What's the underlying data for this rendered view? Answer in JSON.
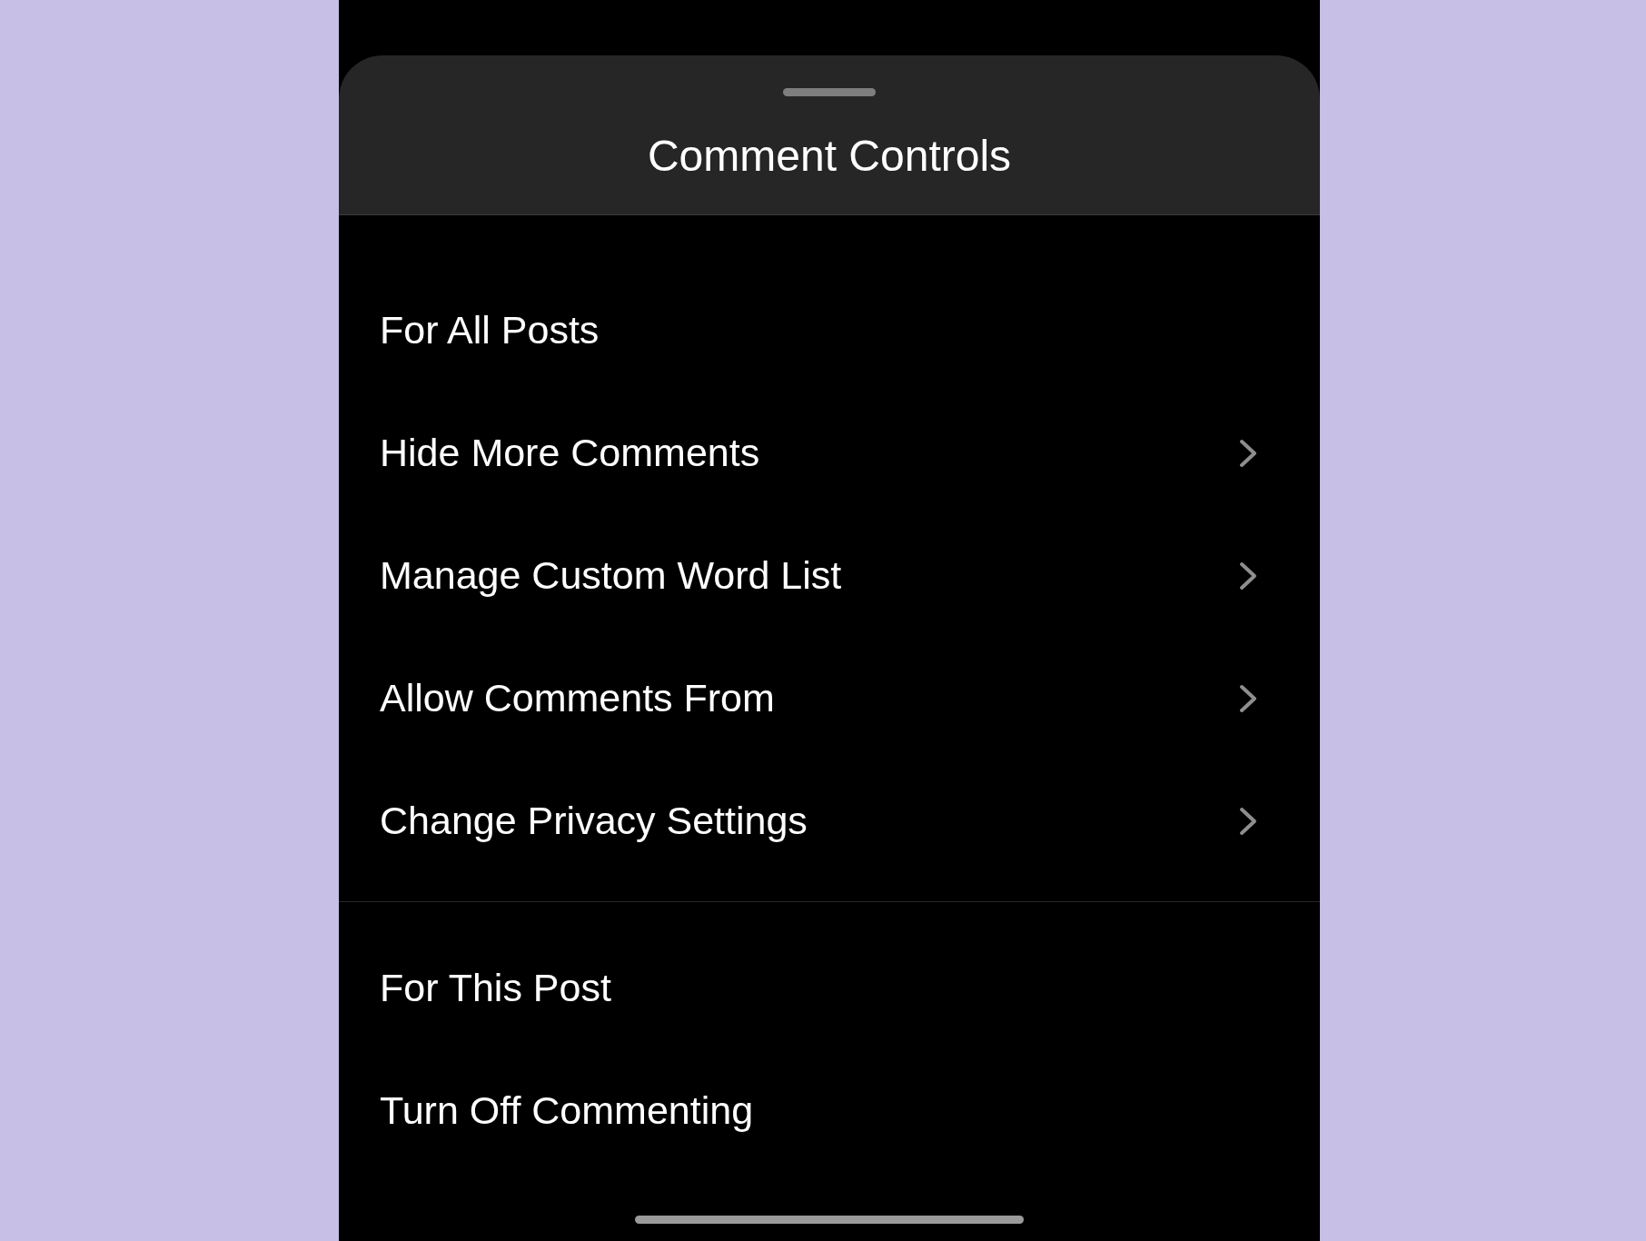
{
  "sheet": {
    "title": "Comment Controls"
  },
  "sections": [
    {
      "heading": "For All Posts",
      "items": [
        {
          "label": "Hide More Comments",
          "kind": "link"
        },
        {
          "label": "Manage Custom Word List",
          "kind": "link"
        },
        {
          "label": "Allow Comments From",
          "kind": "link"
        },
        {
          "label": "Change Privacy Settings",
          "kind": "link"
        }
      ]
    },
    {
      "heading": "For This Post",
      "items": [
        {
          "label": "Turn Off Commenting",
          "kind": "plain"
        }
      ]
    }
  ]
}
